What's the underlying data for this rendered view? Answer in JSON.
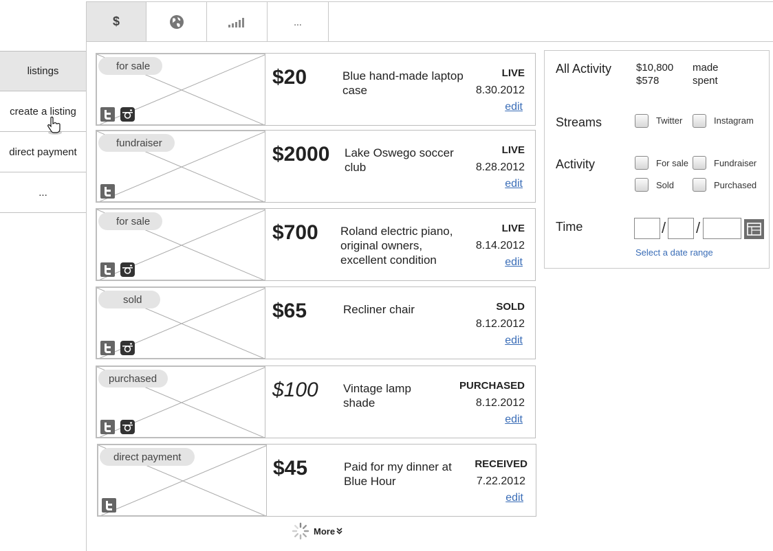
{
  "tabs": [
    {
      "label": "$",
      "icon": "dollar-icon"
    },
    {
      "label": "",
      "icon": "globe-icon"
    },
    {
      "label": "",
      "icon": "signal-bars-icon"
    },
    {
      "label": "...",
      "icon": ""
    }
  ],
  "nav": {
    "items": [
      {
        "label": "listings",
        "active": true
      },
      {
        "label": "create a listing",
        "active": false
      },
      {
        "label": "direct payment",
        "active": false
      },
      {
        "label": "...",
        "active": false
      }
    ]
  },
  "listings": [
    {
      "tag": "for sale",
      "price": "$20",
      "desc": "Blue hand-made laptop case",
      "status": "LIVE",
      "date": "8.30.2012",
      "edit": "edit",
      "social": [
        "twitter",
        "instagram"
      ]
    },
    {
      "tag": "fundraiser",
      "price": "$2000",
      "desc": "Lake Oswego soccer club",
      "status": "LIVE",
      "date": "8.28.2012",
      "edit": "edit",
      "social": [
        "twitter"
      ]
    },
    {
      "tag": "for sale",
      "price": "$700",
      "desc": "Roland electric piano, original owners, excellent condition",
      "status": "LIVE",
      "date": "8.14.2012",
      "edit": "edit",
      "social": [
        "twitter",
        "instagram"
      ]
    },
    {
      "tag": "sold",
      "price": "$65",
      "desc": "Recliner chair",
      "status": "SOLD",
      "date": "8.12.2012",
      "edit": "edit",
      "social": [
        "twitter",
        "instagram"
      ]
    },
    {
      "tag": "purchased",
      "price": "$100",
      "desc": "Vintage lamp shade",
      "status": "PURCHASED",
      "date": "8.12.2012",
      "edit": "edit",
      "social": [
        "twitter",
        "instagram"
      ]
    },
    {
      "tag": "direct payment",
      "price": "$45",
      "desc": "Paid for my dinner at Blue Hour",
      "status": "RECEIVED",
      "date": "7.22.2012",
      "edit": "edit",
      "social": [
        "twitter"
      ]
    }
  ],
  "more": {
    "label": "More"
  },
  "panel": {
    "all_activity": {
      "label": "All Activity",
      "made_amount": "$10,800",
      "spent_amount": "$578",
      "made_label": "made",
      "spent_label": "spent"
    },
    "streams": {
      "label": "Streams",
      "options": [
        "Twitter",
        "Instagram"
      ]
    },
    "activity": {
      "label": "Activity",
      "options": [
        "For sale",
        "Fundraiser",
        "Sold",
        "Purchased"
      ]
    },
    "time": {
      "label": "Time",
      "date_separator": "/",
      "select_range": "Select a date range"
    }
  },
  "colors": {
    "link": "#3a6db7",
    "active_bg": "#e6e6e6",
    "border": "#bdbdbd"
  }
}
